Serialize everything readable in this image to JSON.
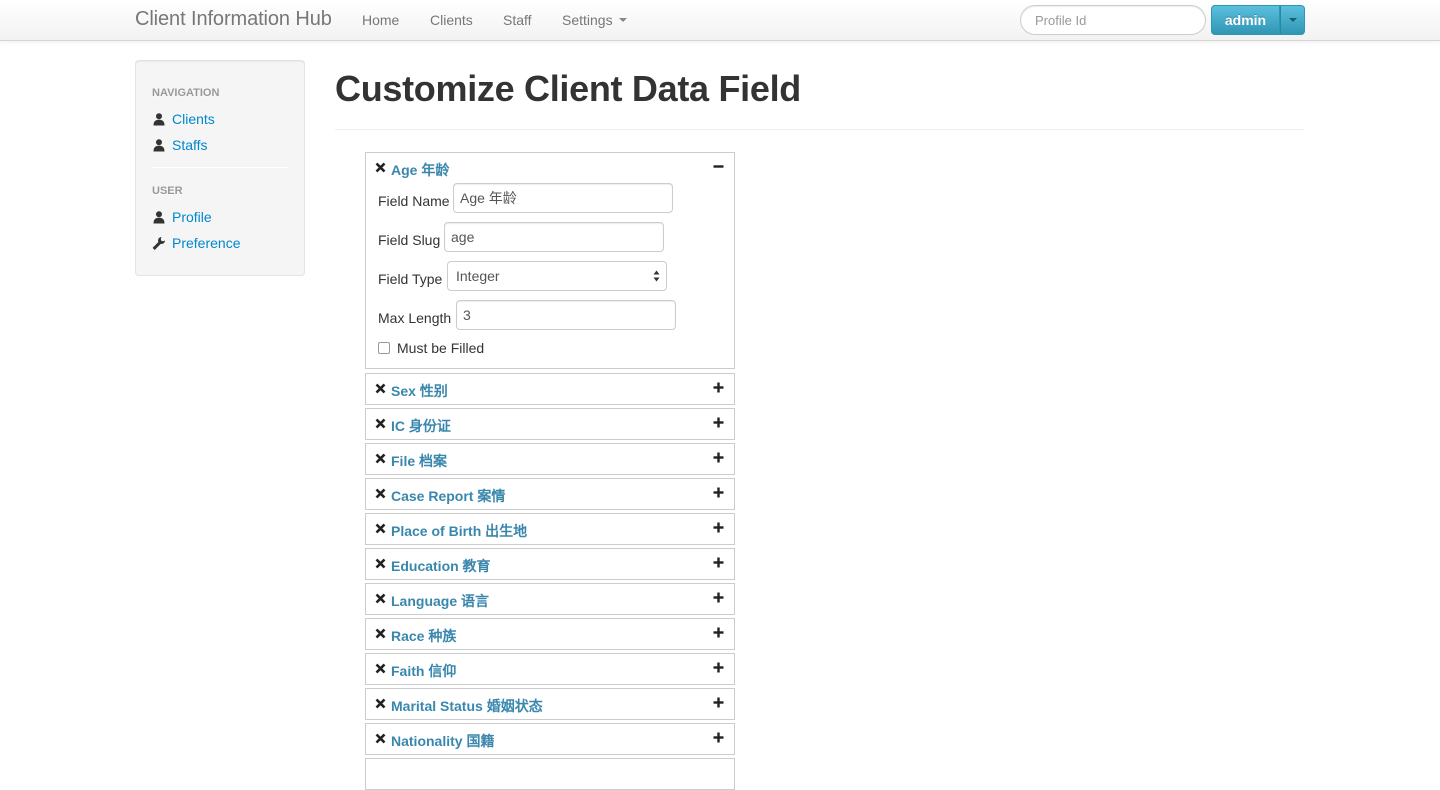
{
  "navbar": {
    "brand": "Client Information Hub",
    "links": [
      {
        "label": "Home"
      },
      {
        "label": "Clients"
      },
      {
        "label": "Staff"
      },
      {
        "label": "Settings"
      }
    ],
    "search_placeholder": "Profile Id",
    "user_button": "admin"
  },
  "sidebar": {
    "nav_header": "NAVIGATION",
    "nav_items": [
      {
        "label": "Clients",
        "icon": "user-icon"
      },
      {
        "label": "Staffs",
        "icon": "user-icon"
      }
    ],
    "user_header": "USER",
    "user_items": [
      {
        "label": "Profile",
        "icon": "user-icon"
      },
      {
        "label": "Preference",
        "icon": "wrench-icon"
      }
    ]
  },
  "main": {
    "title": "Customize Client Data Field",
    "expanded_field": {
      "title": "Age 年龄",
      "field_name_label": "Field Name",
      "field_name_value": "Age 年龄",
      "field_slug_label": "Field Slug",
      "field_slug_value": "age",
      "field_type_label": "Field Type",
      "field_type_value": "Integer",
      "max_length_label": "Max Length",
      "max_length_value": "3",
      "must_fill_label": "Must be Filled",
      "must_fill_checked": false
    },
    "collapsed_fields": [
      {
        "title": "Sex 性别"
      },
      {
        "title": "IC 身份证"
      },
      {
        "title": "File 档案"
      },
      {
        "title": "Case Report 案情"
      },
      {
        "title": "Place of Birth 出生地"
      },
      {
        "title": "Education 教育"
      },
      {
        "title": "Language 语言"
      },
      {
        "title": "Race 种族"
      },
      {
        "title": "Faith 信仰"
      },
      {
        "title": "Marital Status 婚姻状态"
      },
      {
        "title": "Nationality 国籍"
      }
    ]
  },
  "colors": {
    "link": "#0088cc",
    "panel_title": "#3a87ad",
    "admin_button": "#2f96b4"
  }
}
